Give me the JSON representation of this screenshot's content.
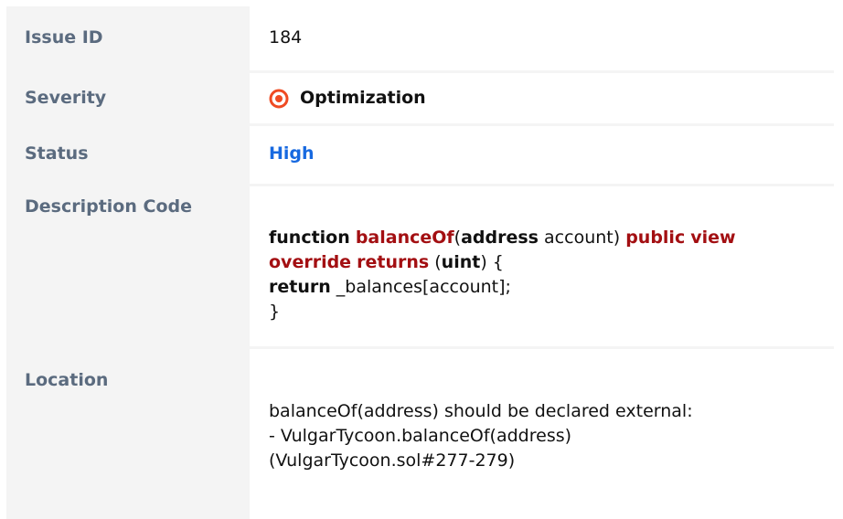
{
  "rows": {
    "issue_id": {
      "label": "Issue ID",
      "value": "184"
    },
    "severity": {
      "label": "Severity",
      "value": "Optimization",
      "icon": "target-icon",
      "icon_color": "#ef4b23"
    },
    "status": {
      "label": "Status",
      "value": "High",
      "value_color": "#1769e0"
    },
    "description": {
      "label": "Description Code",
      "code": {
        "line1": {
          "function_kw": "function",
          "fn_name": "balanceOf",
          "paren_open": "(",
          "address_kw": "address",
          "param": " account) ",
          "public_kw": "public",
          "view_kw": "view"
        },
        "line2": {
          "override_kw": "override",
          "returns_kw": "returns",
          "paren_open": "(",
          "uint_kw": "uint",
          "rest": ") {"
        },
        "line3": {
          "return_kw": "return",
          "rest": " _balances[account];"
        },
        "line4": "}"
      }
    },
    "location": {
      "label": "Location",
      "lines": [
        "balanceOf(address) should be declared external:",
        "- VulgarTycoon.balanceOf(address)",
        "(VulgarTycoon.sol#277-279)"
      ]
    }
  }
}
